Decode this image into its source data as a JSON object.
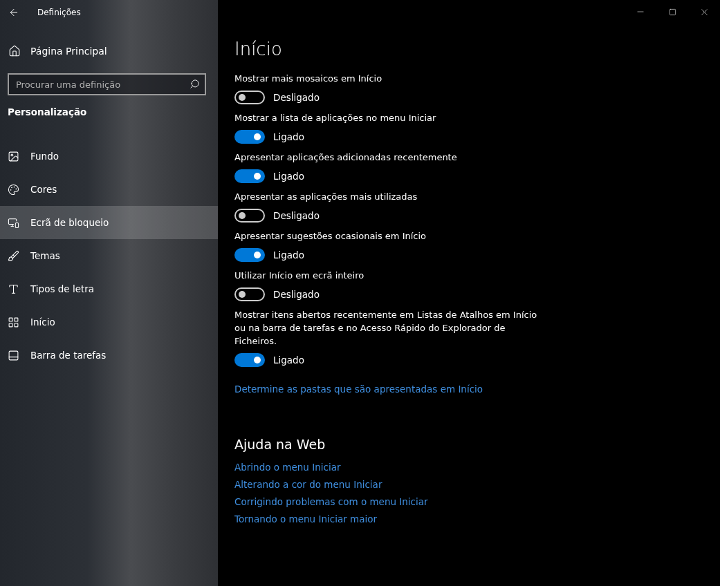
{
  "window": {
    "title": "Definições"
  },
  "sidebar": {
    "home": "Página Principal",
    "search": {
      "placeholder": "Procurar uma definição"
    },
    "section": "Personalização",
    "items": [
      {
        "label": "Fundo",
        "selected": false
      },
      {
        "label": "Cores",
        "selected": false
      },
      {
        "label": "Ecrã de bloqueio",
        "selected": true
      },
      {
        "label": "Temas",
        "selected": false
      },
      {
        "label": "Tipos de letra",
        "selected": false
      },
      {
        "label": "Início",
        "selected": false
      },
      {
        "label": "Barra de tarefas",
        "selected": false
      }
    ]
  },
  "page": {
    "title": "Início",
    "settings": [
      {
        "label": "Mostrar mais mosaicos em Início",
        "on": false,
        "state": "Desligado"
      },
      {
        "label": "Mostrar a lista de aplicações no menu Iniciar",
        "on": true,
        "state": "Ligado"
      },
      {
        "label": "Apresentar aplicações adicionadas recentemente",
        "on": true,
        "state": "Ligado"
      },
      {
        "label": "Apresentar as aplicações mais utilizadas",
        "on": false,
        "state": "Desligado"
      },
      {
        "label": "Apresentar sugestões ocasionais em Início",
        "on": true,
        "state": "Ligado"
      },
      {
        "label": "Utilizar Início em ecrã inteiro",
        "on": false,
        "state": "Desligado"
      },
      {
        "label": "Mostrar itens abertos recentemente em Listas de Atalhos em Início ou na barra de tarefas e no Acesso Rápido do Explorador de Ficheiros.",
        "on": true,
        "state": "Ligado"
      }
    ],
    "link": "Determine as pastas que são apresentadas em Início"
  },
  "help": {
    "title": "Ajuda na Web",
    "links": [
      "Abrindo o menu Iniciar",
      "Alterando a cor do menu Iniciar",
      "Corrigindo problemas com o menu Iniciar",
      "Tornando o menu Iniciar maior"
    ]
  }
}
